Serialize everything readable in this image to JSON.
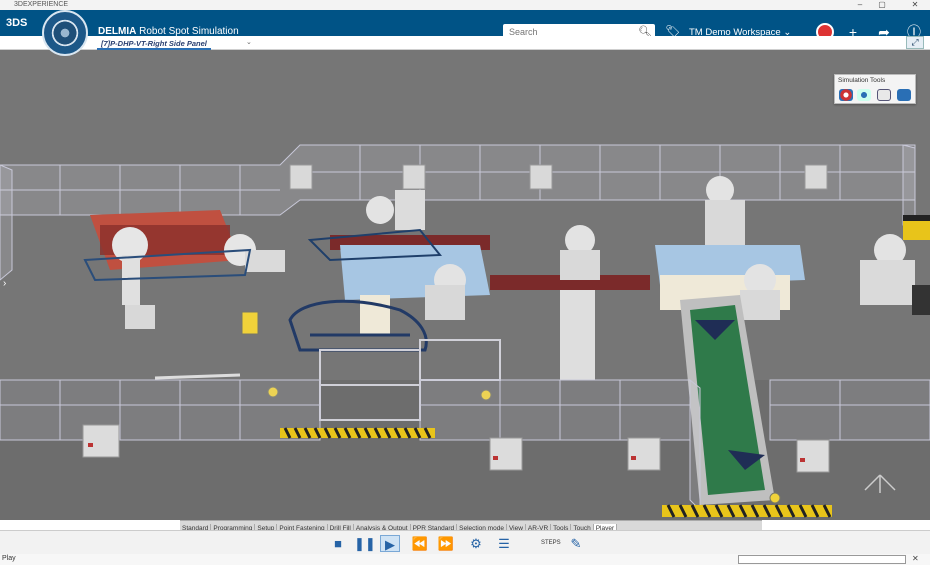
{
  "window": {
    "app_name": "3DEXPERIENCE",
    "controls": [
      "–",
      "▢",
      "✕"
    ]
  },
  "header": {
    "brand": "3DS",
    "app_title_strong": "DELMIA",
    "app_title_rest": " Robot Spot Simulation",
    "search_placeholder": "Search",
    "workspace": "TM Demo Workspace ⌄"
  },
  "tab": {
    "label": "[7]P-DHP-VT-Right Side Panel",
    "caret": "⌄"
  },
  "simulation_tools": {
    "title": "Simulation Tools",
    "icons": [
      "simulate-icon",
      "compass-icon",
      "monitor-icon",
      "robot-icon"
    ]
  },
  "action_bar": {
    "tabs": [
      "Standard",
      "Programming",
      "Setup",
      "Point Fastening",
      "Drill Fill",
      "Analysis & Output",
      "PPR Standard",
      "Selection mode",
      "View",
      "AR-VR",
      "Tools",
      "Touch",
      "Player"
    ],
    "active": "Player"
  },
  "player": {
    "buttons": [
      "stop",
      "pause",
      "play",
      "step-back",
      "step-forward",
      "settings",
      "list"
    ],
    "speed_label": "STEPS"
  },
  "status": {
    "text": "Play"
  },
  "colors": {
    "topbar": "#005386",
    "viewport": "#737373",
    "accent": "#2663a6"
  }
}
